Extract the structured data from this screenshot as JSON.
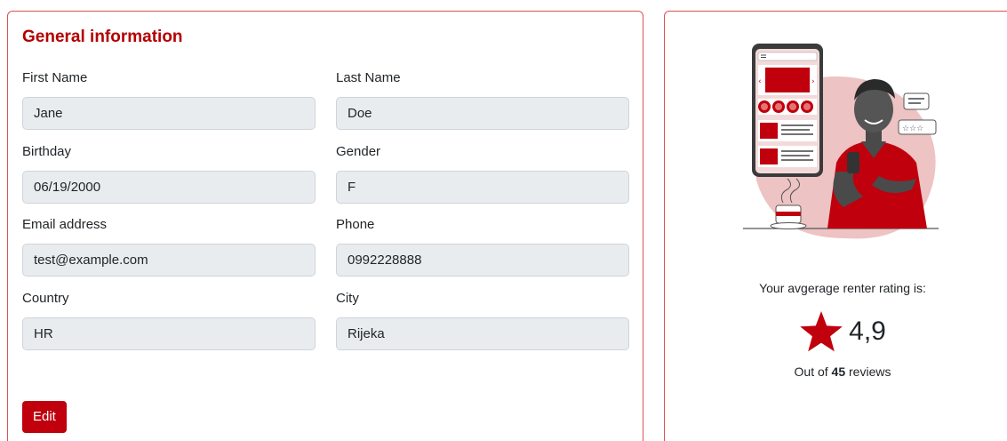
{
  "general": {
    "title": "General information",
    "fields": {
      "first_name": {
        "label": "First Name",
        "value": "Jane"
      },
      "last_name": {
        "label": "Last Name",
        "value": "Doe"
      },
      "birthday": {
        "label": "Birthday",
        "value": "06/19/2000"
      },
      "gender": {
        "label": "Gender",
        "value": "F"
      },
      "email": {
        "label": "Email address",
        "value": "test@example.com"
      },
      "phone": {
        "label": "Phone",
        "value": "0992228888"
      },
      "country": {
        "label": "Country",
        "value": "HR"
      },
      "city": {
        "label": "City",
        "value": "Rijeka"
      }
    },
    "edit_label": "Edit"
  },
  "rating": {
    "label": "Your avgerage renter rating is:",
    "value": "4,9",
    "reviews_prefix": "Out of",
    "reviews_count": "45",
    "reviews_suffix": "reviews"
  },
  "colors": {
    "accent": "#c0000d",
    "title": "#b30000",
    "border": "#d9534f",
    "input_bg": "#e9ecef"
  }
}
